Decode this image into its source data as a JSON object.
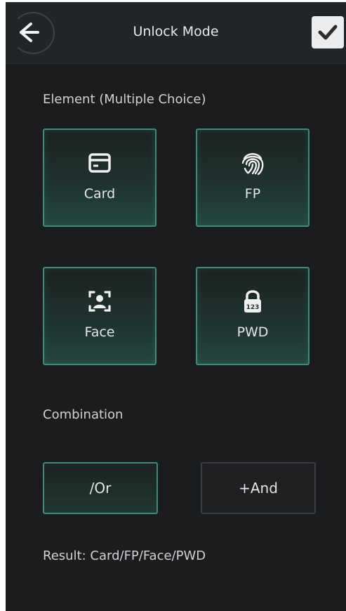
{
  "header": {
    "title": "Unlock Mode",
    "back_icon": "arrow-left-icon",
    "confirm_icon": "check-icon"
  },
  "element_section": {
    "label": "Element (Multiple Choice)",
    "tiles": [
      {
        "label": "Card",
        "icon": "card-icon",
        "selected": true
      },
      {
        "label": "FP",
        "icon": "fingerprint-icon",
        "selected": true
      },
      {
        "label": "Face",
        "icon": "face-icon",
        "selected": true
      },
      {
        "label": "PWD",
        "icon": "password-lock-icon",
        "selected": true
      }
    ]
  },
  "combination_section": {
    "label": "Combination",
    "or_label": "/Or",
    "and_label": "+And",
    "selected": "/Or"
  },
  "result": {
    "text": "Result: Card/FP/Face/PWD"
  },
  "colors": {
    "accent": "#3e8b78",
    "background": "#1a1c1e",
    "header": "#222528"
  }
}
